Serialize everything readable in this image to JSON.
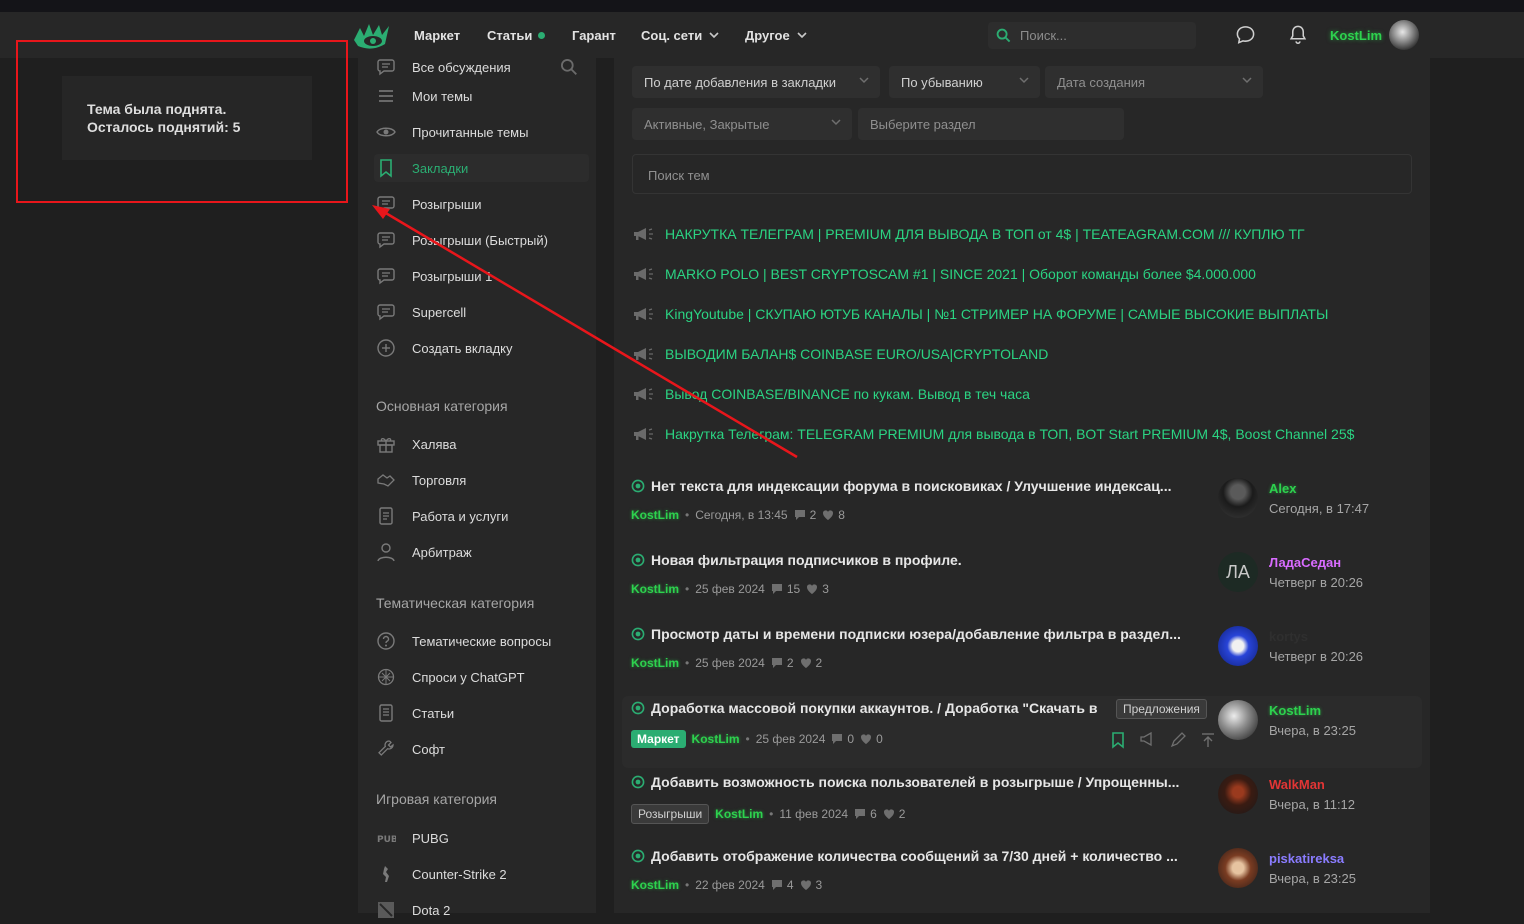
{
  "header": {
    "nav": [
      {
        "label": "Маркет",
        "has_dot": false,
        "has_chevron": false
      },
      {
        "label": "Статьи",
        "has_dot": true,
        "has_chevron": false
      },
      {
        "label": "Гарант",
        "has_dot": false,
        "has_chevron": false
      },
      {
        "label": "Соц. сети",
        "has_dot": false,
        "has_chevron": true
      },
      {
        "label": "Другое",
        "has_dot": false,
        "has_chevron": true
      }
    ],
    "search_placeholder": "Поиск...",
    "username": "KostLim",
    "icons": [
      "logo-icon",
      "search-icon",
      "chat-icon",
      "bell-icon",
      "avatar"
    ]
  },
  "sidebar": {
    "items": [
      {
        "label": "Все обсуждения",
        "icon": "chat-bubble-icon",
        "active": false
      },
      {
        "label": "Мои темы",
        "icon": "list-icon",
        "active": false
      },
      {
        "label": "Прочитанные темы",
        "icon": "eye-icon",
        "active": false
      },
      {
        "label": "Закладки",
        "icon": "bookmark-icon",
        "active": true
      },
      {
        "label": "Розыгрыши",
        "icon": "chat-bubble-icon",
        "active": false
      },
      {
        "label": "Розыгрыши (Быстрый)",
        "icon": "chat-bubble-icon",
        "active": false
      },
      {
        "label": "Розыгрыши 1",
        "icon": "chat-bubble-icon",
        "active": false
      },
      {
        "label": "Supercell",
        "icon": "chat-bubble-icon",
        "active": false
      },
      {
        "label": "Создать вкладку",
        "icon": "plus-circle-icon",
        "active": false
      }
    ],
    "sections": [
      {
        "title": "Основная категория",
        "items": [
          {
            "label": "Халява",
            "icon": "gift-icon"
          },
          {
            "label": "Торговля",
            "icon": "handshake-icon"
          },
          {
            "label": "Работа и услуги",
            "icon": "document-icon"
          },
          {
            "label": "Арбитраж",
            "icon": "person-icon"
          }
        ]
      },
      {
        "title": "Тематическая категория",
        "items": [
          {
            "label": "Тематические вопросы",
            "icon": "question-icon"
          },
          {
            "label": "Спроси у ChatGPT",
            "icon": "openai-icon"
          },
          {
            "label": "Статьи",
            "icon": "article-icon"
          },
          {
            "label": "Софт",
            "icon": "wrench-icon"
          }
        ]
      },
      {
        "title": "Игровая категория",
        "items": [
          {
            "label": "PUBG",
            "icon": "pubg-icon"
          },
          {
            "label": "Counter-Strike 2",
            "icon": "cs-icon"
          },
          {
            "label": "Dota 2",
            "icon": "dota-icon"
          }
        ]
      }
    ]
  },
  "filters": {
    "sort": "По дате добавления в закладки",
    "order": "По убыванию",
    "created": "Дата создания",
    "state": "Активные, Закрытые",
    "section": "Выберите раздел",
    "topic_search": "Поиск тем"
  },
  "announcements": [
    "НАКРУТКА ТЕЛЕГРАМ | PREMIUM ДЛЯ ВЫВОДА В ТОП от 4$ | TEATEAGRAM.COM /// КУПЛЮ ТГ",
    "MARKO POLO | BEST CRYPTOSCAM #1 | SINCE 2021 | Оборот команды более $4.000.000",
    "KingYoutube | СКУПАЮ ЮТУБ КАНАЛЫ | №1 СТРИМЕР НА ФОРУМЕ | САМЫЕ ВЫСОКИЕ ВЫПЛАТЫ",
    "ВЫВОДИМ БАЛАН$ COINBASE EURO/USA|CRYPTOLAND",
    "Вывод COINBASE/BINANCE по кукам. Вывод в теч часа",
    "Накрутка Телеграм: TELEGRAM PREMIUM для вывода в ТОП, BOT Start PREMIUM 4$, Boost Channel 25$"
  ],
  "threads": [
    {
      "title": "Нет текста для индексации форума в поисковиках / Улучшение индексац...",
      "tags": [],
      "author": "KostLim",
      "date": "Сегодня, в 13:45",
      "replies": "2",
      "likes": "8",
      "last_user": "Alex",
      "last_user_color": "#2dd24e",
      "last_date": "Сегодня, в 17:47",
      "avatar": "dark-figure",
      "prefix": "",
      "highlight": false
    },
    {
      "title": "Новая фильтрация подписчиков в профиле.",
      "tags": [],
      "author": "KostLim",
      "date": "25 фев 2024",
      "replies": "15",
      "likes": "3",
      "last_user": "ЛадаСедан",
      "last_user_color": "#d86bff",
      "last_date": "Четверг в 20:26",
      "avatar": "initials",
      "avatar_text": "ЛА",
      "prefix": "",
      "highlight": false
    },
    {
      "title": "Просмотр даты и времени подписки юзера/добавление фильтра в раздел...",
      "tags": [],
      "author": "KostLim",
      "date": "25 фев 2024",
      "replies": "2",
      "likes": "2",
      "last_user": "kortys",
      "last_user_color": "#2f2f2f",
      "last_date": "Четверг в 20:26",
      "avatar": "blue-guitar",
      "prefix": "",
      "highlight": false
    },
    {
      "title": "Доработка массовой покупки аккаунтов. / Доработка \"Скачать в",
      "tags": [
        "Маркет"
      ],
      "tag_style": "green",
      "author": "KostLim",
      "date": "25 фев 2024",
      "replies": "0",
      "likes": "0",
      "last_user": "KostLim",
      "last_user_color": "#2dd24e",
      "last_date": "Вчера, в 23:25",
      "avatar": "gray-swirl",
      "prefix": "Предложения",
      "highlight": true
    },
    {
      "title": "Добавить возможность поиска пользователей в розыгрыше / Упрощенны...",
      "tags": [
        "Розыгрыши"
      ],
      "tag_style": "gray",
      "author": "KostLim",
      "date": "11 фев 2024",
      "replies": "6",
      "likes": "2",
      "last_user": "WalkMan",
      "last_user_color": "#e23535",
      "last_date": "Вчера, в 11:12",
      "avatar": "hood",
      "prefix": "",
      "highlight": false
    },
    {
      "title": "Добавить отображение количества сообщений за 7/30 дней + количество ...",
      "tags": [],
      "author": "KostLim",
      "date": "22 фев 2024",
      "replies": "4",
      "likes": "3",
      "last_user": "piskatireksa",
      "last_user_color": "#8a7cff",
      "last_date": "Вчера, в 23:25",
      "avatar": "fire",
      "prefix": "",
      "highlight": false
    }
  ],
  "toast": {
    "line1": "Тема была поднята.",
    "line2": "Осталось поднятий: 5"
  },
  "annotation": {
    "color": "#e8161b"
  },
  "colors": {
    "accent": "#2bad72",
    "link_green": "#2bd483",
    "username_green": "#2dd24e"
  }
}
